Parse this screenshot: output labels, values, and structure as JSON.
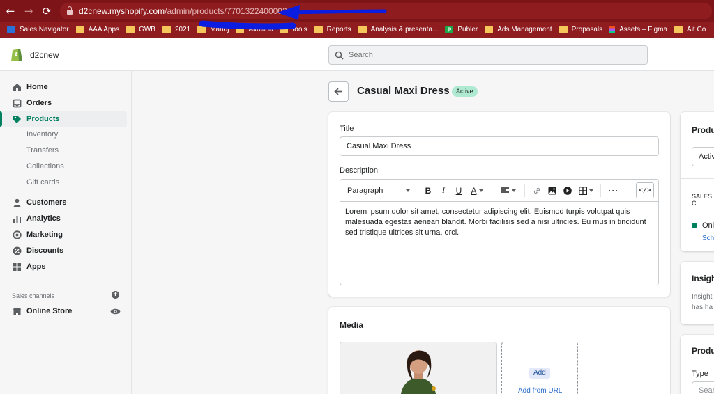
{
  "browser": {
    "url_host": "d2cnew.myshopify.com",
    "url_path": "/admin/products/7701322400002",
    "bookmarks": [
      "Sales Navigator",
      "AAA Apps",
      "GWB",
      "2021",
      "Manoj",
      "Aitrillion",
      "tools",
      "Reports",
      "Analysis & presenta...",
      "Publer",
      "Ads Management",
      "Proposals",
      "Assets – Figma",
      "Ait Co"
    ]
  },
  "header": {
    "store_name": "d2cnew",
    "search_placeholder": "Search"
  },
  "sidebar": {
    "items": [
      {
        "label": "Home",
        "icon": "home-icon"
      },
      {
        "label": "Orders",
        "icon": "orders-icon"
      },
      {
        "label": "Products",
        "icon": "tag-icon",
        "active": true
      },
      {
        "label": "Customers",
        "icon": "person-icon"
      },
      {
        "label": "Analytics",
        "icon": "bar-chart-icon"
      },
      {
        "label": "Marketing",
        "icon": "target-icon"
      },
      {
        "label": "Discounts",
        "icon": "discount-icon"
      },
      {
        "label": "Apps",
        "icon": "apps-grid-icon"
      }
    ],
    "product_subitems": [
      "Inventory",
      "Transfers",
      "Collections",
      "Gift cards"
    ],
    "sales_channels_label": "Sales channels",
    "online_store": "Online Store"
  },
  "page": {
    "title": "Casual Maxi Dress",
    "status_badge": "Active",
    "title_label": "Title",
    "title_value": "Casual Maxi Dress",
    "description_label": "Description",
    "paragraph_select": "Paragraph",
    "description_text": "Lorem ipsum dolor sit amet, consectetur adipiscing elit. Euismod turpis volutpat quis malesuada egestas aenean blandit. Morbi facilisis sed a nisi ultricies. Eu mus in tincidunt sed tristique ultrices sit urna, orci.",
    "media_heading": "Media",
    "add_button": "Add",
    "add_from_url": "Add from URL"
  },
  "right_panel": {
    "status_heading": "Produ",
    "status_select": "Activ",
    "sales_channels": "SALES C",
    "online_store_short": "Onl",
    "schedule_link": "Sch",
    "insights_heading": "Insigh",
    "insights_line1": "Insight",
    "insights_line2": "has ha",
    "org_heading": "Produ",
    "type_label": "Type",
    "type_placeholder": "Sear"
  },
  "colors": {
    "browser_frame": "#7d1518",
    "accent_green": "#008060",
    "badge_green": "#aee9d1",
    "annotation_blue": "#0a1de0"
  }
}
